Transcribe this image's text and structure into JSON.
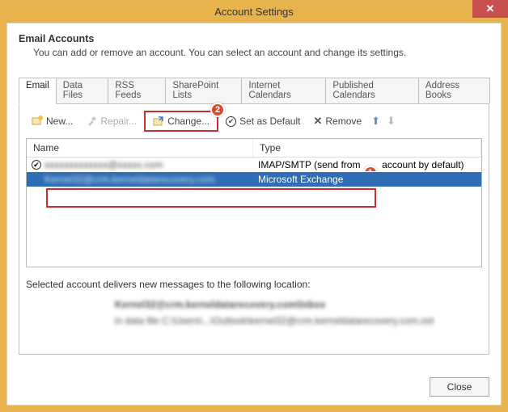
{
  "window": {
    "title": "Account Settings",
    "close_glyph": "✕"
  },
  "header": {
    "title": "Email Accounts",
    "desc": "You can add or remove an account. You can select an account and change its settings."
  },
  "tabs": [
    {
      "label": "Email",
      "active": true
    },
    {
      "label": "Data Files"
    },
    {
      "label": "RSS Feeds"
    },
    {
      "label": "SharePoint Lists"
    },
    {
      "label": "Internet Calendars"
    },
    {
      "label": "Published Calendars"
    },
    {
      "label": "Address Books"
    }
  ],
  "toolbar": {
    "new_label": "New...",
    "repair_label": "Repair...",
    "change_label": "Change...",
    "default_label": "Set as Default",
    "remove_label": "Remove"
  },
  "callouts": {
    "change": "2",
    "row": "1"
  },
  "grid": {
    "columns": {
      "name": "Name",
      "type": "Type"
    },
    "rows": [
      {
        "default": true,
        "name_obscured": "xxxxxxxxxxxxx@xxxxx.com",
        "type_prefix": "IMAP/SMTP (send from ",
        "type_suffix": " account by default)"
      },
      {
        "selected": true,
        "name_obscured": "Kernel32@crm.kerneldatarecovery.com",
        "type": "Microsoft Exchange"
      }
    ]
  },
  "location": {
    "label": "Selected account delivers new messages to the following location:",
    "line1_obscured": "Kernel32@crm.kerneldatarecovery.com\\Inbox",
    "line2_obscured": "in data file C:\\Users\\...\\Outlook\\kernel32@crm.kerneldatarecovery.com.ost"
  },
  "footer": {
    "close_label": "Close"
  }
}
